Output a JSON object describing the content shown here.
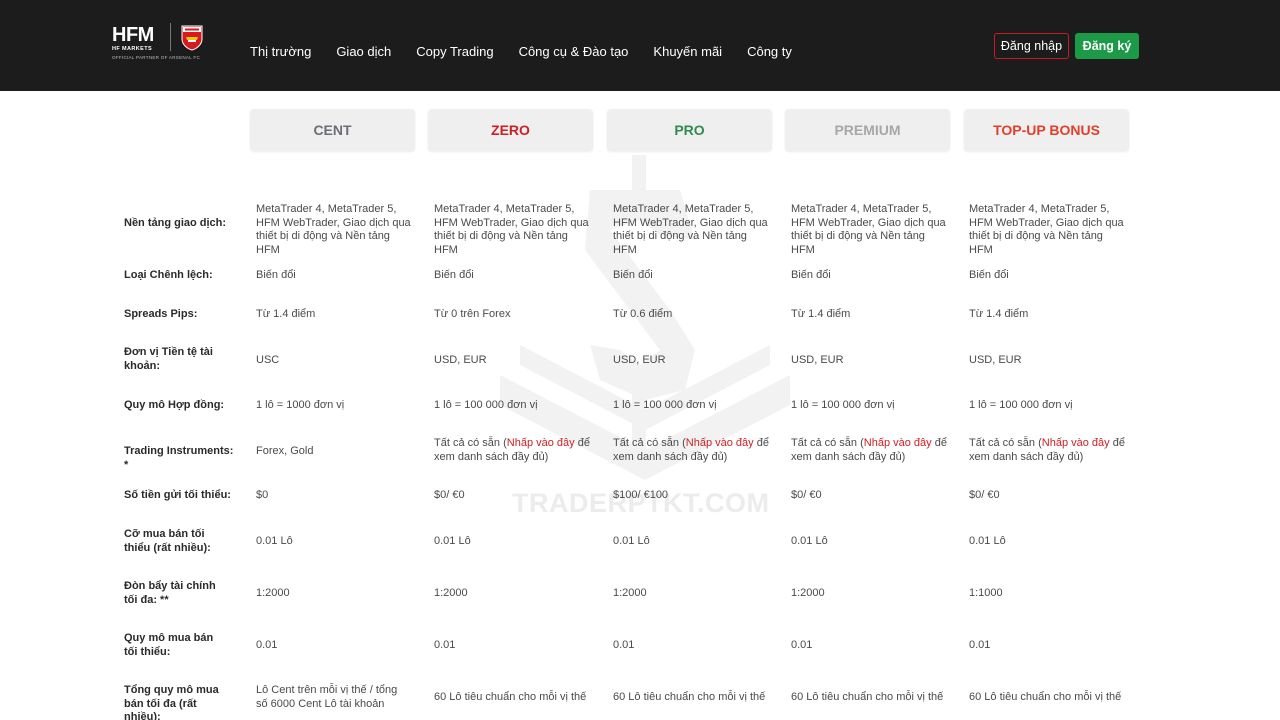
{
  "header": {
    "logo_text": "HFM",
    "logo_sub": "HF MARKETS",
    "logo_partner": "OFFICIAL PARTNER OF ARSENAL FC",
    "nav": [
      "Thị trường",
      "Giao dịch",
      "Copy Trading",
      "Công cụ & Đào tạo",
      "Khuyến mãi",
      "Công ty"
    ],
    "login_label": "Đăng nhập",
    "register_label": "Đăng ký",
    "colors": {
      "bar": "#1c1c1c",
      "login_border": "#c41e24",
      "register_bg": "#1c9a48"
    }
  },
  "tabs": [
    {
      "label": "CENT",
      "color": "#6b6f75"
    },
    {
      "label": "ZERO",
      "color": "#cc1f26"
    },
    {
      "label": "PRO",
      "color": "#2f8b4e"
    },
    {
      "label": "PREMIUM",
      "color": "#a7a7a7"
    },
    {
      "label": "TOP-UP BONUS",
      "color": "#e0402a"
    }
  ],
  "watermark": {
    "text": "TRADERPTKT.COM"
  },
  "rows": [
    {
      "label": "Nền tảng giao dịch:",
      "cells": [
        "MetaTrader 4, MetaTrader 5, HFM WebTrader, Giao dịch qua thiết bị di động và Nền tảng HFM",
        "MetaTrader 4, MetaTrader 5, HFM WebTrader, Giao dịch qua thiết bị di động và Nền tảng HFM",
        "MetaTrader 4, MetaTrader 5, HFM WebTrader, Giao dịch qua thiết bị di động và Nền tảng HFM",
        "MetaTrader 4, MetaTrader 5, HFM WebTrader, Giao dịch qua thiết bị di động và Nền tảng HFM",
        "MetaTrader 4, MetaTrader 5, HFM WebTrader, Giao dịch qua thiết bị di động và Nền tảng HFM"
      ]
    },
    {
      "label": "Loại Chênh lệch:",
      "cells": [
        "Biến đổi",
        "Biến đổi",
        "Biến đổi",
        "Biến đổi",
        "Biến đổi"
      ]
    },
    {
      "label": "Spreads Pips:",
      "cells": [
        "Từ 1.4 điểm",
        "Từ 0 trên Forex",
        "Từ 0.6 điểm",
        "Từ 1.4 điểm",
        "Từ 1.4 điểm"
      ]
    },
    {
      "label": "Đơn vị Tiền tệ tài khoản:",
      "cells": [
        "USC",
        "USD, EUR",
        "USD, EUR",
        "USD, EUR",
        "USD, EUR"
      ]
    },
    {
      "label": "Quy mô Hợp đồng:",
      "cells": [
        "1 lô = 1000 đơn vị",
        "1 lô = 100 000 đơn vị",
        "1 lô = 100 000 đơn vị",
        "1 lô = 100 000 đơn vị",
        "1 lô = 100 000 đơn vị"
      ]
    },
    {
      "label": "Trading Instruments: *",
      "first": "Forex, Gold",
      "pre": "Tất cả có sẵn (",
      "link": "Nhấp vào đây",
      "post": " để xem danh sách đầy đủ)"
    },
    {
      "label": "Số tiền gửi tối thiểu:",
      "cells": [
        "$0",
        "$0/ €0",
        "$100/ €100",
        "$0/ €0",
        "$0/ €0"
      ]
    },
    {
      "label": "Cỡ mua bán tối thiểu (rất nhiều):",
      "cells": [
        "0.01 Lô",
        "0.01 Lô",
        "0.01 Lô",
        "0.01 Lô",
        "0.01 Lô"
      ]
    },
    {
      "label": "Đòn bẩy tài chính tối đa: **",
      "cells": [
        "1:2000",
        "1:2000",
        "1:2000",
        "1:2000",
        "1:1000"
      ]
    },
    {
      "label": "Quy mô mua bán tối thiểu:",
      "cells": [
        "0.01",
        "0.01",
        "0.01",
        "0.01",
        "0.01"
      ]
    },
    {
      "label": "Tổng quy mô mua bán tối đa (rất nhiều):",
      "cells": [
        "Lô Cent trên mỗi vị thế / tổng số 6000 Cent Lô tài khoản",
        "60 Lô tiêu chuẩn cho mỗi vị thế",
        "60 Lô tiêu chuẩn cho mỗi vị thế",
        "60 Lô tiêu chuẩn cho mỗi vị thế",
        "60 Lô tiêu chuẩn cho mỗi vị thế"
      ]
    }
  ]
}
